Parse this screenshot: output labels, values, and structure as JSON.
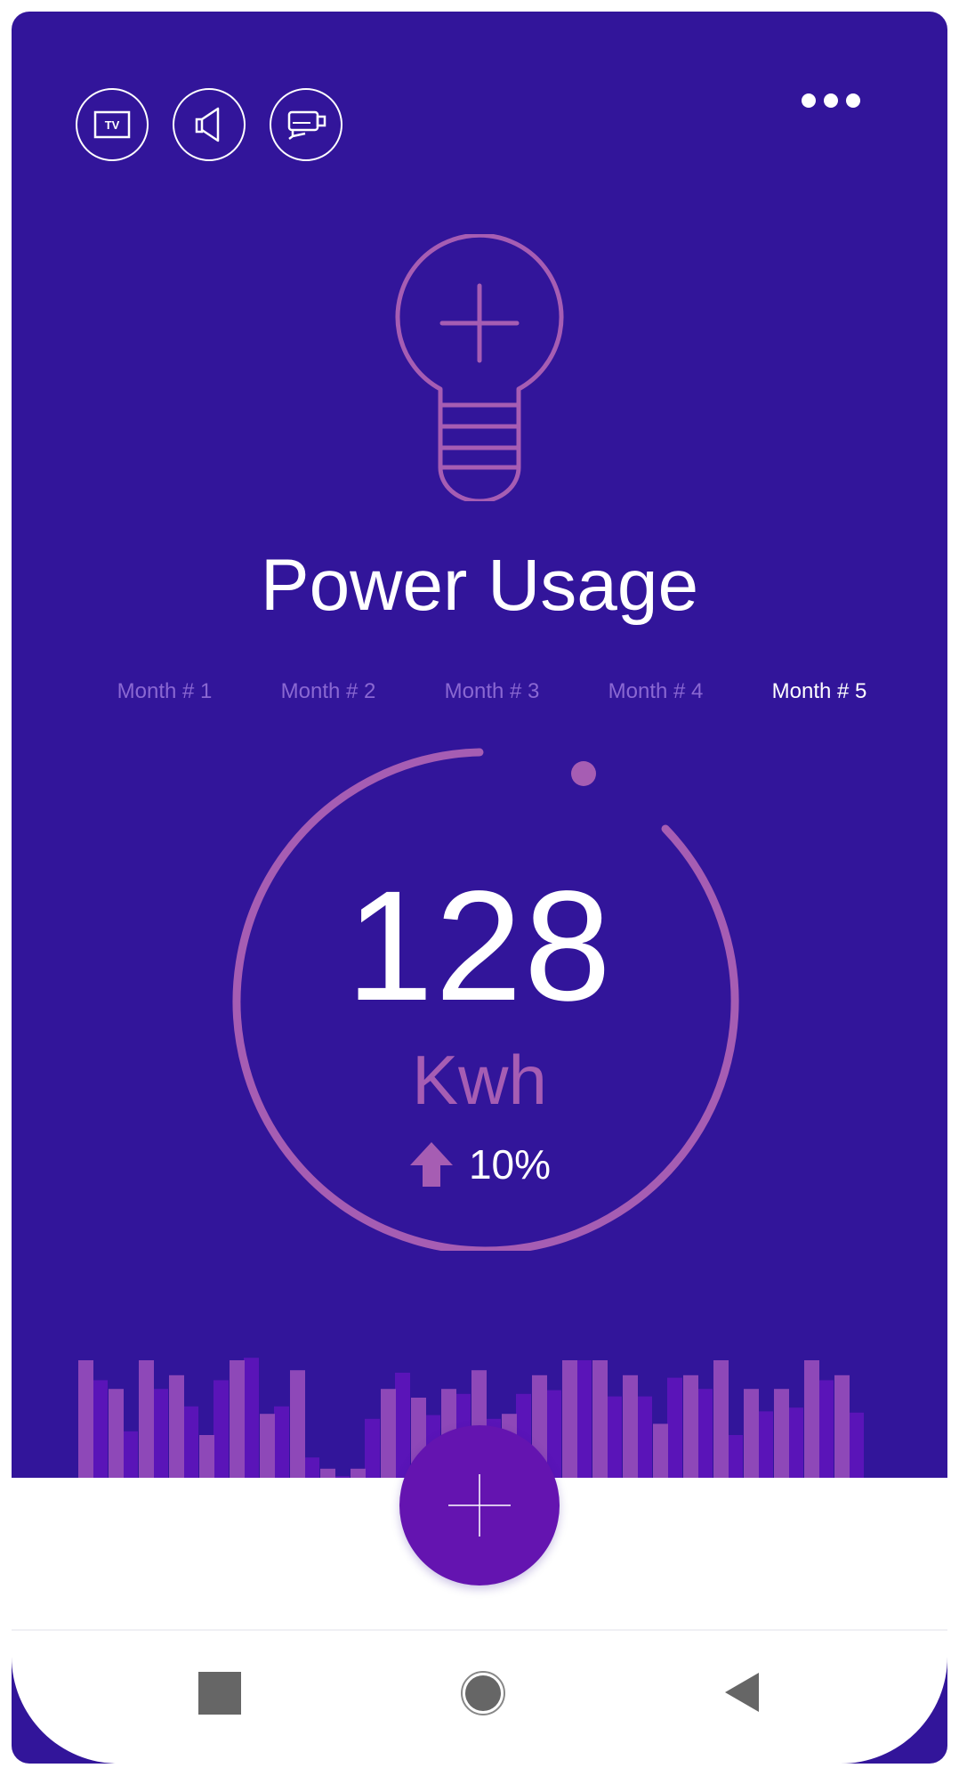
{
  "header": {
    "device_icons": [
      "tv-icon",
      "speaker-icon",
      "projector-icon"
    ],
    "tv_label": "TV",
    "menu_icon": "more-horizontal-icon"
  },
  "hero": {
    "icon": "lightbulb-plus-icon",
    "title": "Power Usage"
  },
  "tabs": [
    {
      "label": "Month # 1",
      "active": false
    },
    {
      "label": "Month # 2",
      "active": false
    },
    {
      "label": "Month # 3",
      "active": false
    },
    {
      "label": "Month # 4",
      "active": false
    },
    {
      "label": "Month # 5",
      "active": true
    }
  ],
  "gauge": {
    "value": "128",
    "unit": "Kwh",
    "change": "10%",
    "trend_icon": "arrow-up-icon"
  },
  "usage_bars": {
    "primary_levels": [
      0.95,
      0.72,
      0.95,
      0.83,
      0.35,
      0.95,
      0.52,
      0.87,
      0.08,
      0.08,
      0.72,
      0.65,
      0.72,
      0.87,
      0.52,
      0.83,
      0.95,
      0.95,
      0.83,
      0.44,
      0.83,
      0.95,
      0.72,
      0.72,
      0.95,
      0.83
    ],
    "secondary_levels": [
      0.79,
      0.38,
      0.72,
      0.58,
      0.79,
      0.97,
      0.58,
      0.17,
      0.02,
      0.48,
      0.85,
      0.51,
      0.68,
      0.48,
      0.68,
      0.71,
      0.95,
      0.66,
      0.66,
      0.81,
      0.72,
      0.35,
      0.54,
      0.57,
      0.79,
      0.53
    ]
  },
  "fab_icon": "plus-icon",
  "navigation": [
    "recent-apps-icon",
    "home-icon",
    "back-icon"
  ],
  "colors": {
    "background": "#32159a",
    "accent": "#a65db3",
    "inactive_tab": "#8a68d2",
    "fab": "#6414b0",
    "bar_secondary": "#5a14b8"
  }
}
